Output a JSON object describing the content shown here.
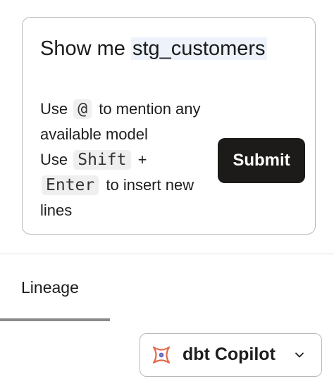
{
  "prompt": {
    "prefix": "Show me ",
    "mention": "stg_customers"
  },
  "help": {
    "use1": "Use ",
    "at_key": "@",
    "mention_text": " to mention any available model",
    "use2": "Use ",
    "shift_key": "Shift",
    "plus": " + ",
    "enter_key": "Enter",
    "newline_text": " to insert new lines"
  },
  "submit_label": "Submit",
  "tabs": {
    "lineage_label": "Lineage"
  },
  "copilot": {
    "label": "dbt Copilot",
    "icon": "dbt-copilot-logo-icon"
  },
  "colors": {
    "accent_orange": "#e8694a",
    "accent_blue": "#5b6fd6",
    "button_dark": "#1c1b19"
  }
}
